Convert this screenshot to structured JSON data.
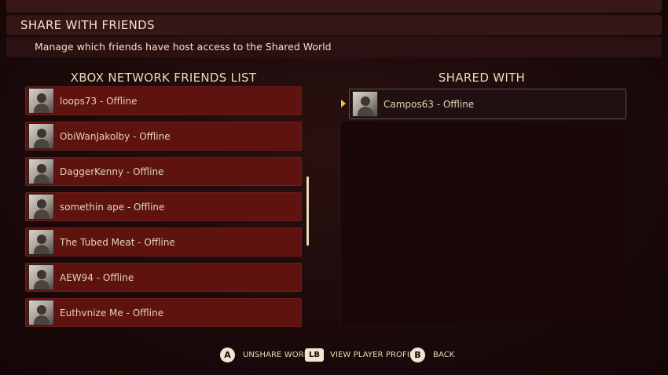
{
  "header": {
    "title": "SHARE WITH FRIENDS",
    "subtitle": "Manage which friends have host access to the Shared World"
  },
  "friends_list": {
    "title": "XBOX NETWORK FRIENDS LIST",
    "items": [
      {
        "label": "loops73 - Offline"
      },
      {
        "label": "ObiWanJakolby - Offline"
      },
      {
        "label": "DaggerKenny - Offline"
      },
      {
        "label": "somethin ape - Offline"
      },
      {
        "label": "The Tubed Meat - Offline"
      },
      {
        "label": "AEW94 - Offline"
      },
      {
        "label": "Euthvnize Me - Offline"
      }
    ]
  },
  "shared_with": {
    "title": "SHARED WITH",
    "items": [
      {
        "label": "Campos63 - Offline"
      }
    ]
  },
  "footer": {
    "unshare": {
      "button": "A",
      "label": "UNSHARE WORLD"
    },
    "profile": {
      "button": "LB",
      "label": "VIEW PLAYER PROFILE"
    },
    "back": {
      "button": "B",
      "label": "BACK"
    }
  },
  "colors": {
    "background": "#1c0a0b",
    "row": "#5e130f",
    "text": "#e9dbb7",
    "accent": "#f1c040"
  }
}
